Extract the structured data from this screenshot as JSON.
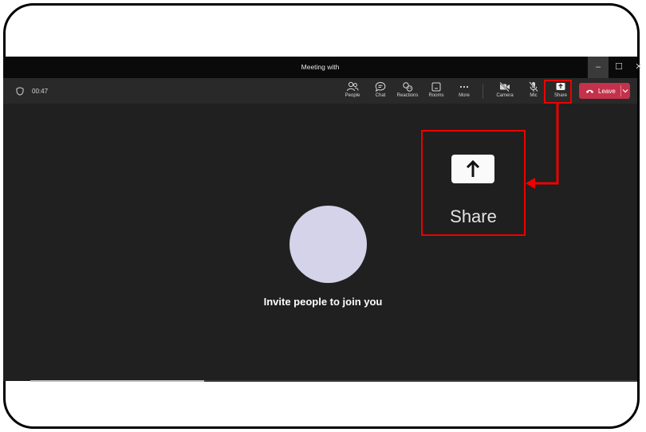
{
  "window": {
    "title": "Meeting with",
    "controls": {
      "minimize": "–",
      "maximize": "☐",
      "close": "✕"
    }
  },
  "toolbar": {
    "timer": "00:47",
    "items": [
      {
        "id": "people",
        "label": "People",
        "icon": "people-icon"
      },
      {
        "id": "chat",
        "label": "Chat",
        "icon": "chat-icon"
      },
      {
        "id": "reactions",
        "label": "Reactions",
        "icon": "reactions-icon"
      },
      {
        "id": "rooms",
        "label": "Rooms",
        "icon": "rooms-icon"
      },
      {
        "id": "more",
        "label": "More",
        "icon": "more-icon"
      },
      {
        "id": "camera",
        "label": "Camera",
        "icon": "camera-off-icon"
      },
      {
        "id": "mic",
        "label": "Mic",
        "icon": "mic-off-icon"
      },
      {
        "id": "share",
        "label": "Share",
        "icon": "share-icon"
      }
    ],
    "leave_label": "Leave"
  },
  "zoom_callout": {
    "label": "Share"
  },
  "stage": {
    "invite_text": "Invite people to join you"
  },
  "colors": {
    "leave": "#c4314b",
    "highlight": "#e00000",
    "avatar": "#d4d3ea"
  }
}
